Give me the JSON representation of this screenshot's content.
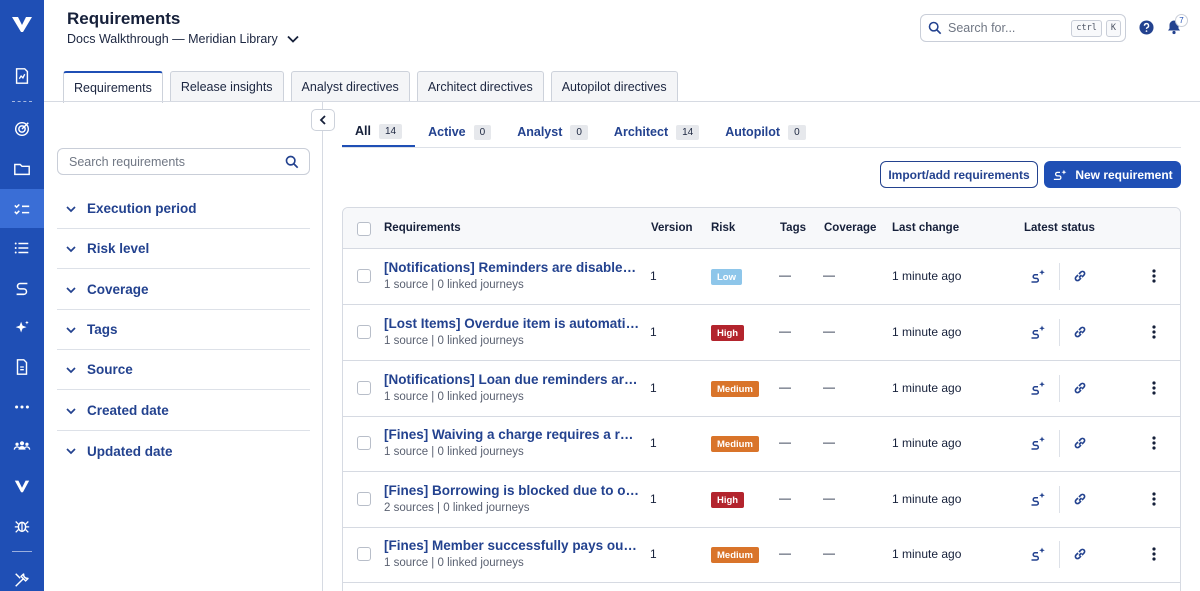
{
  "header": {
    "title": "Requirements",
    "project": "Docs Walkthrough — Meridian Library",
    "search_placeholder": "Search for...",
    "kbd_ctrl": "ctrl",
    "kbd_k": "K",
    "notification_count": "7"
  },
  "tabs": [
    {
      "label": "Requirements",
      "active": true
    },
    {
      "label": "Release insights"
    },
    {
      "label": "Analyst directives"
    },
    {
      "label": "Architect directives"
    },
    {
      "label": "Autopilot directives"
    }
  ],
  "filters": {
    "search_placeholder": "Search requirements",
    "facets": [
      "Execution period",
      "Risk level",
      "Coverage",
      "Tags",
      "Source",
      "Created date",
      "Updated date"
    ]
  },
  "subtabs": [
    {
      "label": "All",
      "count": "14",
      "active": true
    },
    {
      "label": "Active",
      "count": "0"
    },
    {
      "label": "Analyst",
      "count": "0"
    },
    {
      "label": "Architect",
      "count": "14"
    },
    {
      "label": "Autopilot",
      "count": "0"
    }
  ],
  "actions": {
    "import_label": "Import/add requirements",
    "new_label": "New requirement"
  },
  "table": {
    "columns": {
      "requirements": "Requirements",
      "version": "Version",
      "risk": "Risk",
      "tags": "Tags",
      "coverage": "Coverage",
      "last_change": "Last change",
      "latest_status": "Latest status"
    },
    "rows": [
      {
        "title": "[Notifications] Reminders are disabled ...",
        "sub": "1 source | 0 linked journeys",
        "version": "1",
        "risk": "Low",
        "tags": "—",
        "coverage": "—",
        "last_change": "1 minute ago"
      },
      {
        "title": "[Lost Items] Overdue item is automatic...",
        "sub": "1 source | 0 linked journeys",
        "version": "1",
        "risk": "High",
        "tags": "—",
        "coverage": "—",
        "last_change": "1 minute ago"
      },
      {
        "title": "[Notifications] Loan due reminders are ...",
        "sub": "1 source | 0 linked journeys",
        "version": "1",
        "risk": "Medium",
        "tags": "—",
        "coverage": "—",
        "last_change": "1 minute ago"
      },
      {
        "title": "[Fines] Waiving a charge requires a rea...",
        "sub": "1 source | 0 linked journeys",
        "version": "1",
        "risk": "Medium",
        "tags": "—",
        "coverage": "—",
        "last_change": "1 minute ago"
      },
      {
        "title": "[Fines] Borrowing is blocked due to out...",
        "sub": "2 sources | 0 linked journeys",
        "version": "1",
        "risk": "High",
        "tags": "—",
        "coverage": "—",
        "last_change": "1 minute ago"
      },
      {
        "title": "[Fines] Member successfully pays outs...",
        "sub": "1 source | 0 linked journeys",
        "version": "1",
        "risk": "Medium",
        "tags": "—",
        "coverage": "—",
        "last_change": "1 minute ago"
      }
    ]
  },
  "colors": {
    "rail": "#1f4fb5",
    "accent": "#1f4fb5",
    "link": "#23428f",
    "risk_low": "#8ec6ea",
    "risk_high": "#b3242d",
    "risk_medium": "#d9742a"
  },
  "icons": {
    "rail": [
      "logo-icon",
      "report-icon",
      "target-icon",
      "folder-icon",
      "checklist-icon",
      "list-icon",
      "flow-icon",
      "sparkle-icon",
      "document-icon",
      "more-icon",
      "team-icon",
      "brand-icon",
      "bug-icon",
      "tools-icon"
    ]
  }
}
